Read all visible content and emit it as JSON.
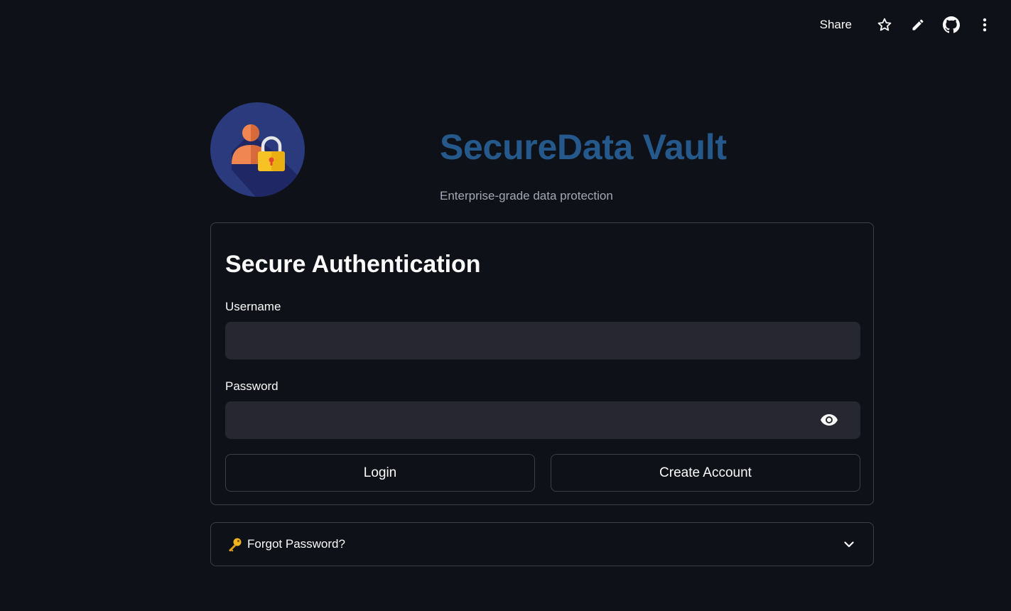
{
  "toolbar": {
    "share_label": "Share",
    "icons": [
      "star-icon",
      "pencil-icon",
      "github-icon",
      "kebab-menu-icon"
    ]
  },
  "header": {
    "logo_icon": "user-lock-icon",
    "title": "SecureData Vault",
    "subtitle": "Enterprise-grade data protection"
  },
  "auth": {
    "heading": "Secure Authentication",
    "username": {
      "label": "Username",
      "value": "",
      "placeholder": ""
    },
    "password": {
      "label": "Password",
      "value": "",
      "placeholder": ""
    },
    "login_label": "Login",
    "create_account_label": "Create Account"
  },
  "forgot": {
    "icon": "key-icon",
    "label": "Forgot Password?",
    "expanded": false
  },
  "colors": {
    "background": "#0e1117",
    "title": "#26598b",
    "input_bg": "#262730",
    "logo_circle": "#2b3a7d"
  }
}
